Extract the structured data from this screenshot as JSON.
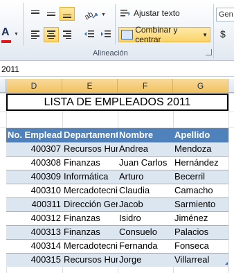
{
  "ribbon": {
    "wrap_text_label": "Ajustar texto",
    "merge_center_label": "Combinar y centrar",
    "group_label": "Alineación",
    "font_box_text": "Gen",
    "currency_symbol": "$",
    "font_color_letter": "A"
  },
  "formula_bar": {
    "value": "2011"
  },
  "columns": [
    "D",
    "E",
    "F",
    "G"
  ],
  "sheet": {
    "title": "LISTA DE EMPLEADOS 2011",
    "table": {
      "headers": [
        "No. Empleado",
        "Departamento",
        "Nombre",
        "Apellido"
      ],
      "rows": [
        [
          "400307",
          "Recursos Humanos",
          "Andrea",
          "Mendoza"
        ],
        [
          "400308",
          "Finanzas",
          "Juan Carlos",
          "Hernández"
        ],
        [
          "400309",
          "Informática",
          "Arturo",
          "Becerril"
        ],
        [
          "400310",
          "Mercadotecnia",
          "Claudia",
          "Camacho"
        ],
        [
          "400311",
          "Dirección General",
          "Jacob",
          "Sarmiento"
        ],
        [
          "400312",
          "Finanzas",
          "Isidro",
          "Jiménez"
        ],
        [
          "400313",
          "Finanzas",
          "Consuelo",
          "Palacios"
        ],
        [
          "400314",
          "Mercadotecnia",
          "Fernanda",
          "Fonseca"
        ],
        [
          "400315",
          "Recursos Humanos",
          "Jorge",
          "Villarreal"
        ]
      ]
    }
  },
  "colors": {
    "header_fill": "#4f81bd",
    "band_fill": "#dce6f1",
    "accent_orange": "#fcd46a",
    "font_color_bar": "#e01a1a"
  }
}
